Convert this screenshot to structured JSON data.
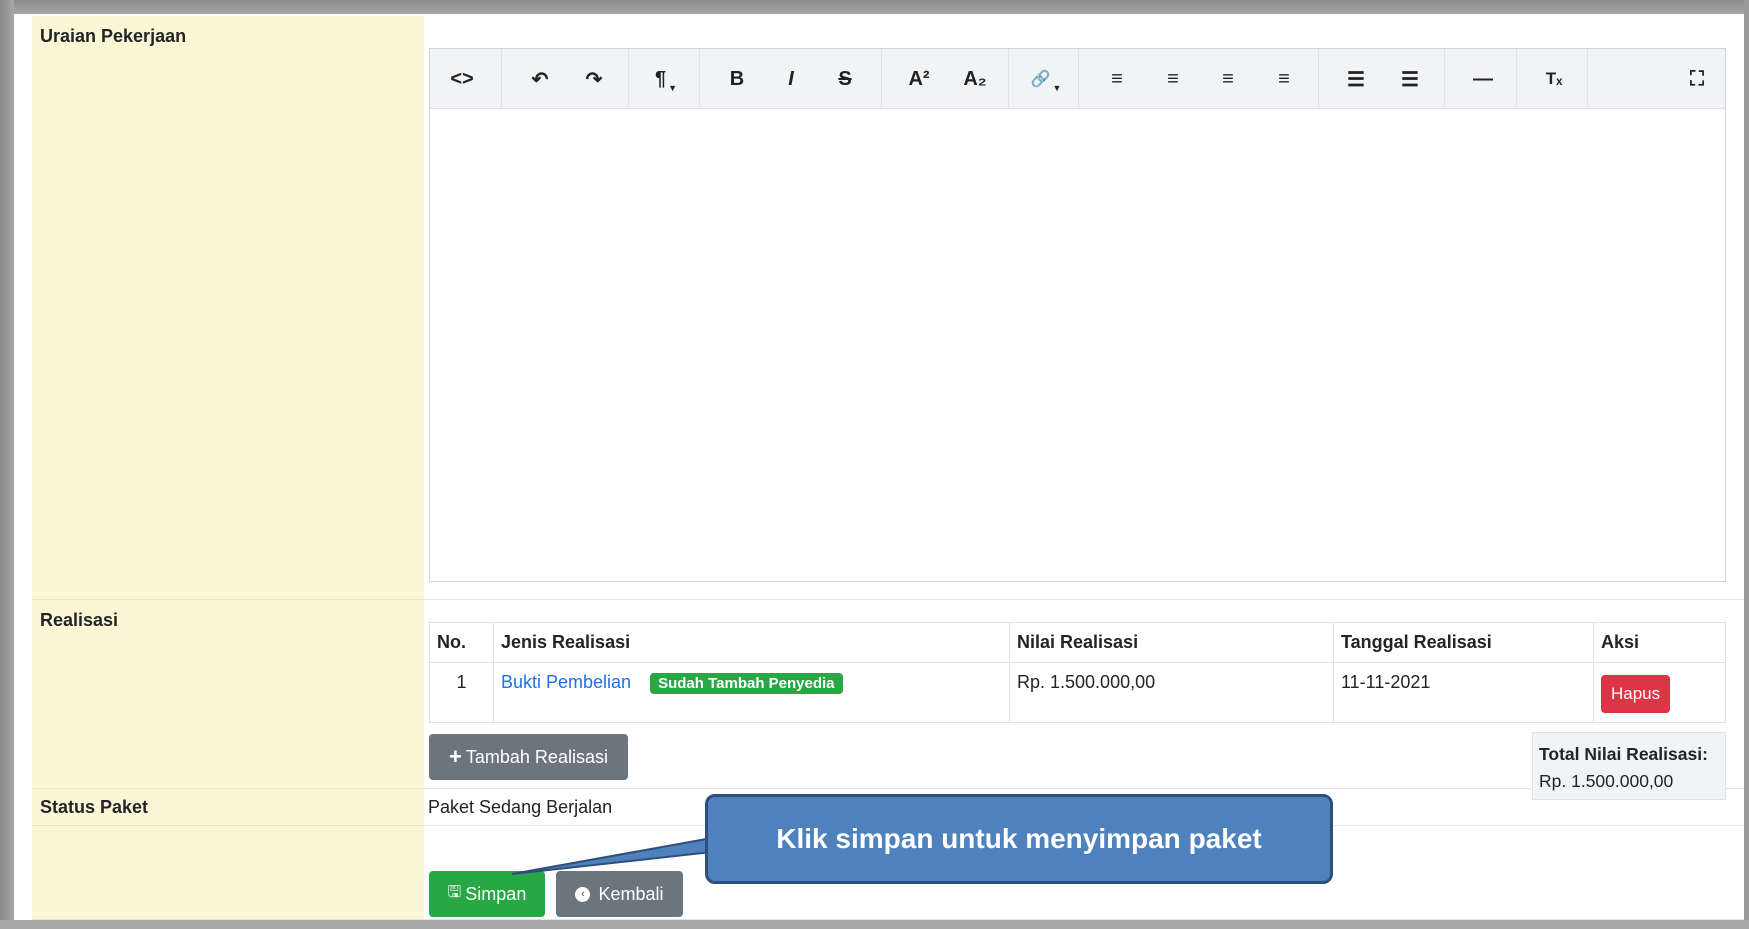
{
  "form": {
    "uraian_label": "Uraian Pekerjaan",
    "realisasi_label": "Realisasi",
    "status_label": "Status Paket",
    "status_value": "Paket Sedang Berjalan"
  },
  "editor": {
    "toolbar": [
      {
        "name": "code-view-icon",
        "glyph": "<>"
      },
      {
        "name": "undo-icon",
        "glyph": "↶"
      },
      {
        "name": "redo-icon",
        "glyph": "↷"
      },
      {
        "name": "paragraph-icon",
        "glyph": "¶"
      },
      {
        "name": "bold-icon",
        "glyph": "B"
      },
      {
        "name": "italic-icon",
        "glyph": "I"
      },
      {
        "name": "strikethrough-icon",
        "glyph": "S"
      },
      {
        "name": "superscript-icon",
        "glyph": "A²"
      },
      {
        "name": "subscript-icon",
        "glyph": "A₂"
      },
      {
        "name": "link-icon",
        "glyph": "🔗"
      },
      {
        "name": "align-left-icon",
        "glyph": "≡"
      },
      {
        "name": "align-center-icon",
        "glyph": "≡"
      },
      {
        "name": "align-right-icon",
        "glyph": "≡"
      },
      {
        "name": "align-justify-icon",
        "glyph": "≡"
      },
      {
        "name": "unordered-list-icon",
        "glyph": "☰"
      },
      {
        "name": "ordered-list-icon",
        "glyph": "☰"
      },
      {
        "name": "horizontal-rule-icon",
        "glyph": "—"
      },
      {
        "name": "clear-format-icon",
        "glyph": "Tₓ"
      },
      {
        "name": "fullscreen-icon",
        "glyph": "⛶"
      }
    ]
  },
  "table": {
    "headers": {
      "no": "No.",
      "jenis": "Jenis Realisasi",
      "nilai": "Nilai Realisasi",
      "tanggal": "Tanggal Realisasi",
      "aksi": "Aksi"
    },
    "rows": [
      {
        "no": "1",
        "jenis": "Bukti Pembelian",
        "badge": "Sudah Tambah Penyedia",
        "nilai": "Rp. 1.500.000,00",
        "tanggal": "11-11-2021",
        "aksi": "Hapus"
      }
    ]
  },
  "actions": {
    "tambah_label": "Tambah Realisasi",
    "total_label": "Total Nilai Realisasi:",
    "total_value": "Rp. 1.500.000,00",
    "simpan_label": "Simpan",
    "kembali_label": "Kembali"
  },
  "callout": {
    "text": "Klik simpan untuk menyimpan paket"
  },
  "colors": {
    "label_bg": "#fdf6d4",
    "success": "#28a745",
    "danger": "#dc3545",
    "secondary": "#6c757d",
    "callout": "#4f81bd"
  }
}
